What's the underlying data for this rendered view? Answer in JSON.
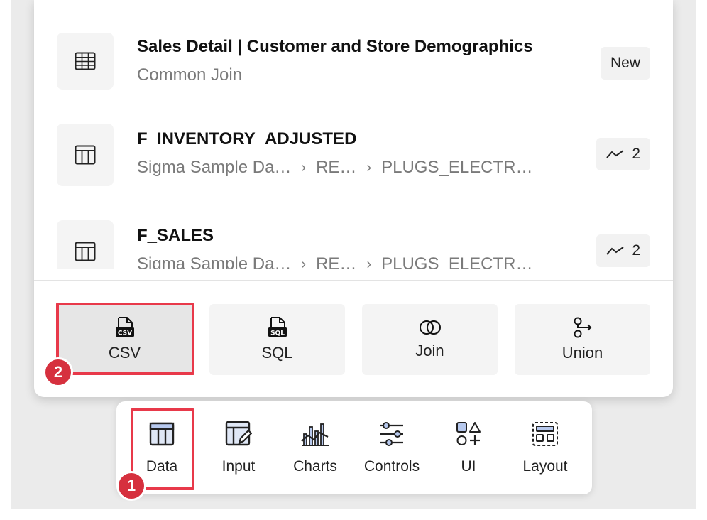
{
  "data_list": {
    "items": [
      {
        "title": "Sales Detail | Customer and Store Demographics",
        "subtitle": "Common Join",
        "badge_label": "New",
        "icon": "table-grid-icon"
      },
      {
        "title": "F_INVENTORY_ADJUSTED",
        "path": [
          "Sigma Sample Da…",
          "RE…",
          "PLUGS_ELECTR…"
        ],
        "badge_count": "2",
        "badge_icon": "lineage-icon",
        "icon": "table-icon"
      },
      {
        "title": "F_SALES",
        "path": [
          "Sigma Sample Da…",
          "RE…",
          "PLUGS_ELECTR…"
        ],
        "badge_count": "2",
        "badge_icon": "lineage-icon",
        "icon": "table-icon"
      }
    ]
  },
  "sources": {
    "buttons": [
      {
        "label": "CSV",
        "icon": "csv-file-icon"
      },
      {
        "label": "SQL",
        "icon": "sql-file-icon"
      },
      {
        "label": "Join",
        "icon": "join-icon"
      },
      {
        "label": "Union",
        "icon": "union-icon"
      }
    ]
  },
  "toolbar": {
    "items": [
      {
        "label": "Data",
        "icon": "data-table-icon"
      },
      {
        "label": "Input",
        "icon": "input-table-icon"
      },
      {
        "label": "Charts",
        "icon": "charts-icon"
      },
      {
        "label": "Controls",
        "icon": "sliders-icon"
      },
      {
        "label": "UI",
        "icon": "shapes-icon"
      },
      {
        "label": "Layout",
        "icon": "layout-icon"
      }
    ]
  },
  "annotations": {
    "step1": "1",
    "step2": "2",
    "highlight_color": "#e8394a"
  }
}
